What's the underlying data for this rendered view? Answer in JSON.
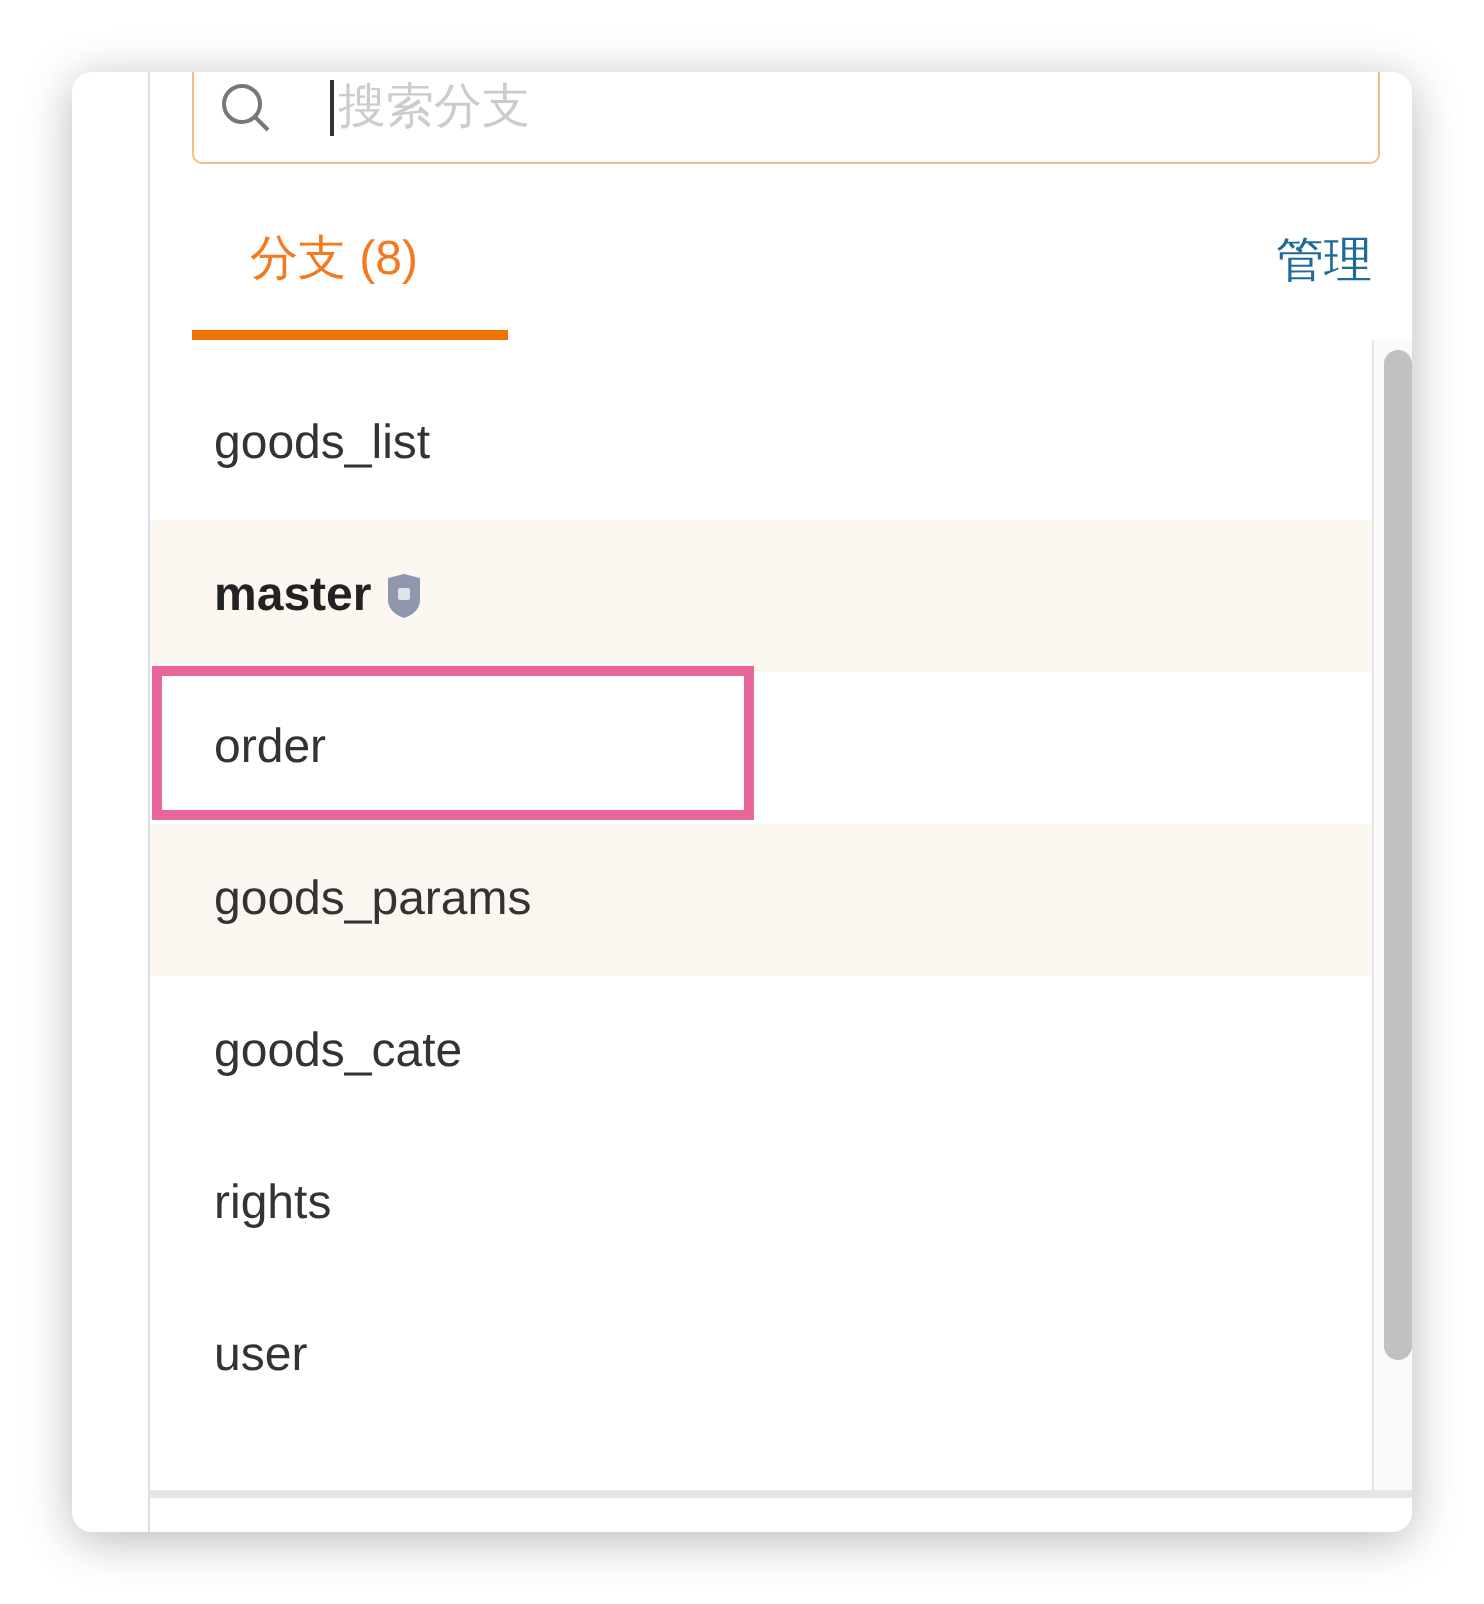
{
  "search": {
    "placeholder": "搜索分支"
  },
  "tabs": [
    {
      "label": "分支 (8)",
      "selected": true
    }
  ],
  "manage_link": "管理",
  "branches": [
    {
      "name": "goods_list",
      "highlighted": false,
      "protected": false,
      "annotated": false
    },
    {
      "name": "master",
      "highlighted": true,
      "protected": true,
      "annotated": false
    },
    {
      "name": "order",
      "highlighted": false,
      "protected": false,
      "annotated": true
    },
    {
      "name": "goods_params",
      "highlighted": true,
      "protected": false,
      "annotated": false
    },
    {
      "name": "goods_cate",
      "highlighted": false,
      "protected": false,
      "annotated": false
    },
    {
      "name": "rights",
      "highlighted": false,
      "protected": false,
      "annotated": false
    },
    {
      "name": "user",
      "highlighted": false,
      "protected": false,
      "annotated": false
    }
  ]
}
